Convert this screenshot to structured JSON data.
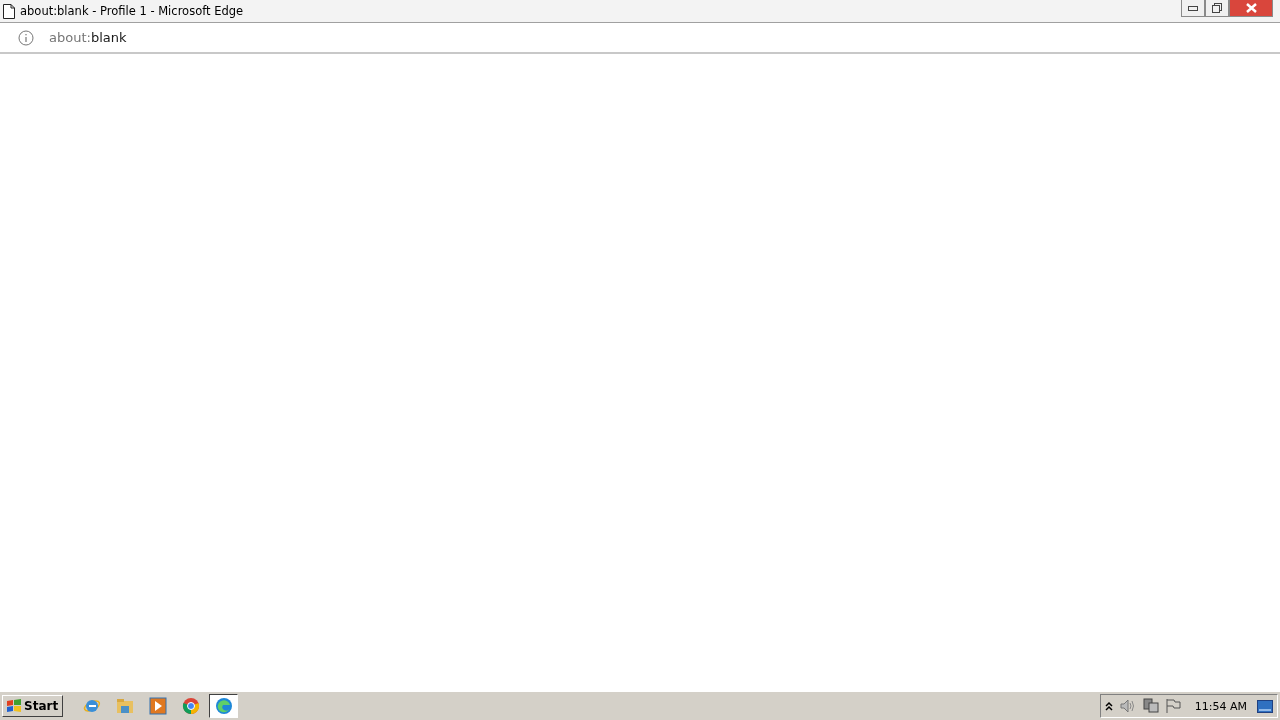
{
  "window": {
    "title": "about:blank - Profile 1 - Microsoft Edge"
  },
  "address_bar": {
    "scheme": "about:",
    "rest": "blank"
  },
  "taskbar": {
    "start": "Start",
    "apps": [
      {
        "kind": "ie",
        "selected": false
      },
      {
        "kind": "folder",
        "selected": false
      },
      {
        "kind": "media",
        "selected": false
      },
      {
        "kind": "chrome",
        "selected": false
      },
      {
        "kind": "edge",
        "selected": true
      }
    ],
    "tray": {
      "time": "11:54 AM"
    }
  }
}
